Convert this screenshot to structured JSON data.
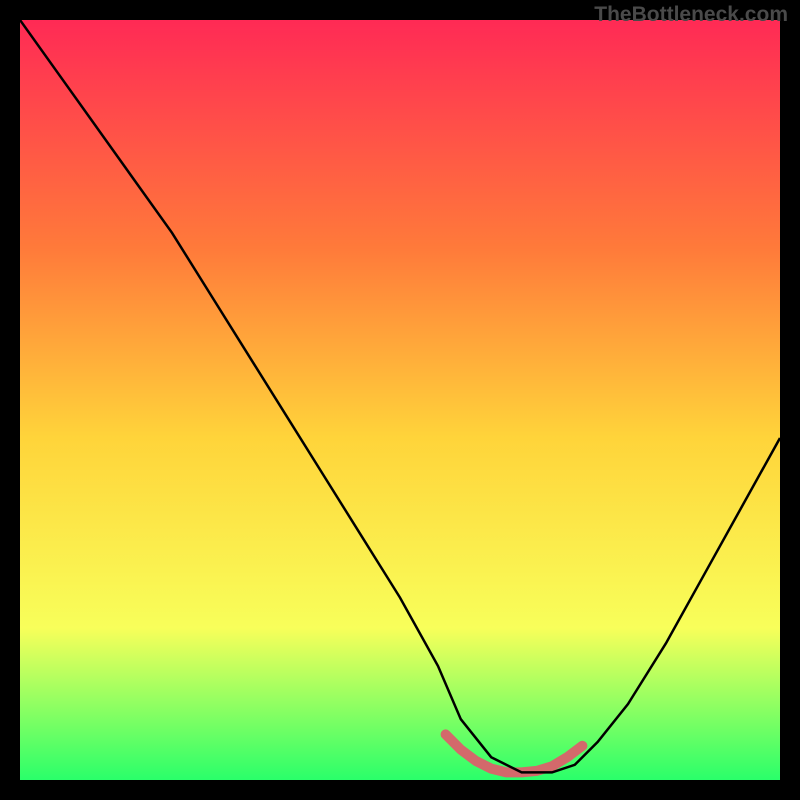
{
  "watermark": "TheBottleneck.com",
  "chart_data": {
    "type": "line",
    "title": "",
    "xlabel": "",
    "ylabel": "",
    "xlim": [
      0,
      100
    ],
    "ylim": [
      0,
      100
    ],
    "background_gradient": {
      "top": "#ff2a55",
      "upper_mid": "#ff7a3a",
      "mid": "#ffd43a",
      "lower_mid": "#f8ff5a",
      "bottom": "#2aff6a"
    },
    "series": [
      {
        "name": "bottleneck-curve",
        "color": "#000000",
        "x": [
          0,
          5,
          10,
          15,
          20,
          25,
          30,
          35,
          40,
          45,
          50,
          55,
          58,
          62,
          66,
          70,
          73,
          76,
          80,
          85,
          90,
          95,
          100
        ],
        "values": [
          100,
          93,
          86,
          79,
          72,
          64,
          56,
          48,
          40,
          32,
          24,
          15,
          8,
          3,
          1,
          1,
          2,
          5,
          10,
          18,
          27,
          36,
          45
        ]
      }
    ],
    "highlight_segment": {
      "name": "optimal-range",
      "color": "#d3696b",
      "x": [
        56,
        58,
        60,
        62,
        64,
        66,
        68,
        70,
        72,
        74
      ],
      "values": [
        6.0,
        4.0,
        2.5,
        1.5,
        1.0,
        1.0,
        1.2,
        1.8,
        3.0,
        4.5
      ]
    }
  }
}
